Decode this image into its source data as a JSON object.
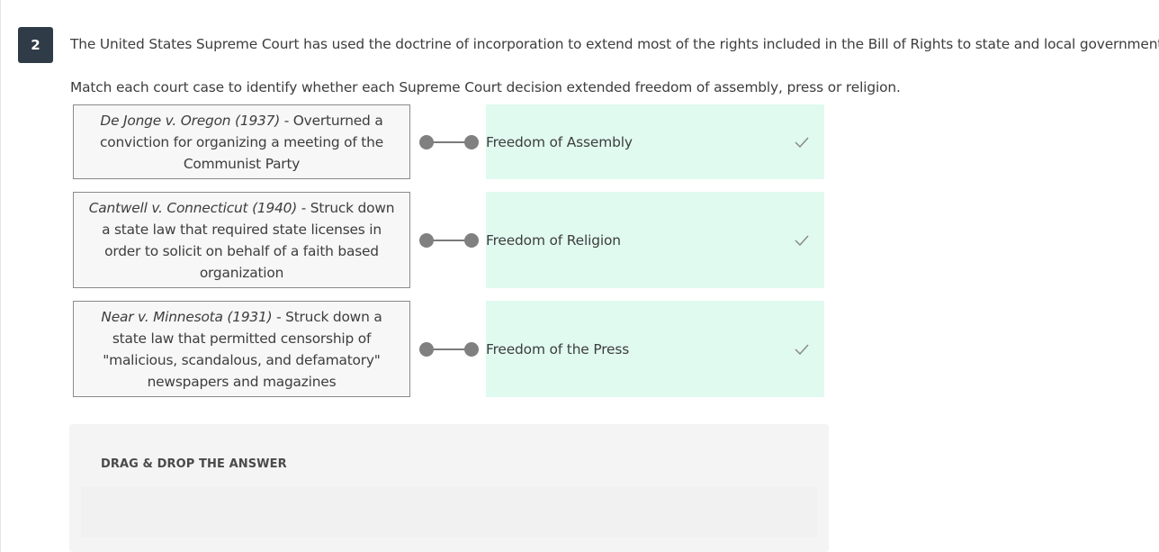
{
  "question": {
    "number": "2",
    "stem": "The United States Supreme Court has used the doctrine of incorporation to extend most of the rights included in the Bill of Rights to state and local governments.",
    "instruction": "Match each court case to identify whether each Supreme Court decision extended freedom of assembly, press or religion."
  },
  "pairs": [
    {
      "case": "De Jonge v. Oregon (1937)",
      "description": " - Overturned a conviction for organizing a meeting of the Communist Party",
      "answer": "Freedom of Assembly",
      "status": "correct"
    },
    {
      "case": "Cantwell v. Connecticut (1940)",
      "description": " - Struck down a state law that required state licenses in order to solicit on behalf of a faith based organization",
      "answer": "Freedom of Religion",
      "status": "correct"
    },
    {
      "case": "Near v. Minnesota (1931)",
      "description": " - Struck down a state law that permitted censorship of \"malicious, scandalous, and defamatory\" newspapers and magazines",
      "answer": "Freedom of the Press",
      "status": "correct"
    }
  ],
  "answer_bank": {
    "title": "DRAG & DROP THE ANSWER"
  },
  "colors": {
    "badge_bg": "#2f3b47",
    "answer_bg": "#e0faf0",
    "prompt_bg": "#f7f7f7",
    "connector": "#808080",
    "check": "#8a8a8a"
  },
  "icons": {
    "status": "check-icon"
  }
}
